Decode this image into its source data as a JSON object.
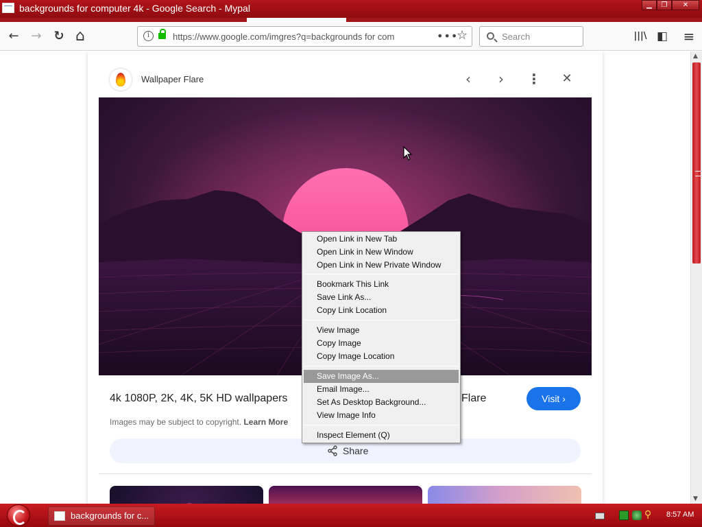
{
  "window": {
    "title": "backgrounds for computer 4k - Google Search - Mypal",
    "minimize": "▁",
    "maximize": "❐",
    "close": "✕"
  },
  "nav": {
    "back": "←",
    "forward": "→",
    "reload": "↻",
    "home": "⌂",
    "url": "https://www.google.com/imgres?q=backgrounds for com",
    "info": "i",
    "page_actions": "•••",
    "bookmark_star": "☆",
    "search_placeholder": "Search",
    "library": "|||\\",
    "sidebar": "◧",
    "menu": "≡"
  },
  "panel": {
    "source_name": "Wallpaper Flare",
    "prev": "‹",
    "next": "›",
    "more": "⋮",
    "close": "✕",
    "image_title": "4k 1080P, 2K, 4K, 5K HD wallpapers",
    "image_title_tail": "Flare",
    "visit_label": "Visit ›",
    "copyright_text": "Images may be subject to copyright.",
    "learn_more": "Learn More",
    "share_label": "Share"
  },
  "context_menu": {
    "items": [
      {
        "label": "Open Link in New Tab"
      },
      {
        "label": "Open Link in New Window"
      },
      {
        "label": "Open Link in New Private Window"
      },
      {
        "label": "Bookmark This Link"
      },
      {
        "label": "Save Link As..."
      },
      {
        "label": "Copy Link Location"
      },
      {
        "label": "View Image"
      },
      {
        "label": "Copy Image"
      },
      {
        "label": "Copy Image Location"
      },
      {
        "label": "Save Image As...",
        "highlighted": true
      },
      {
        "label": "Email Image..."
      },
      {
        "label": "Set As Desktop Background..."
      },
      {
        "label": "View Image Info"
      },
      {
        "label": "Inspect Element (Q)"
      }
    ]
  },
  "taskbar": {
    "task_label": "backgrounds for c...",
    "clock": "8:57 AM"
  },
  "colors": {
    "accent": "#b3141a",
    "visit_button": "#1a73e8",
    "share_button": "#eef3fd",
    "menu_highlight": "#999999"
  },
  "icons": [
    "app-icon",
    "info-icon",
    "lock-icon",
    "star-icon",
    "search-icon",
    "library-icon",
    "sidebar-icon",
    "hamburger-menu-icon",
    "flame-logo-icon",
    "share-icon",
    "start-orb-icon",
    "cursor-icon"
  ]
}
